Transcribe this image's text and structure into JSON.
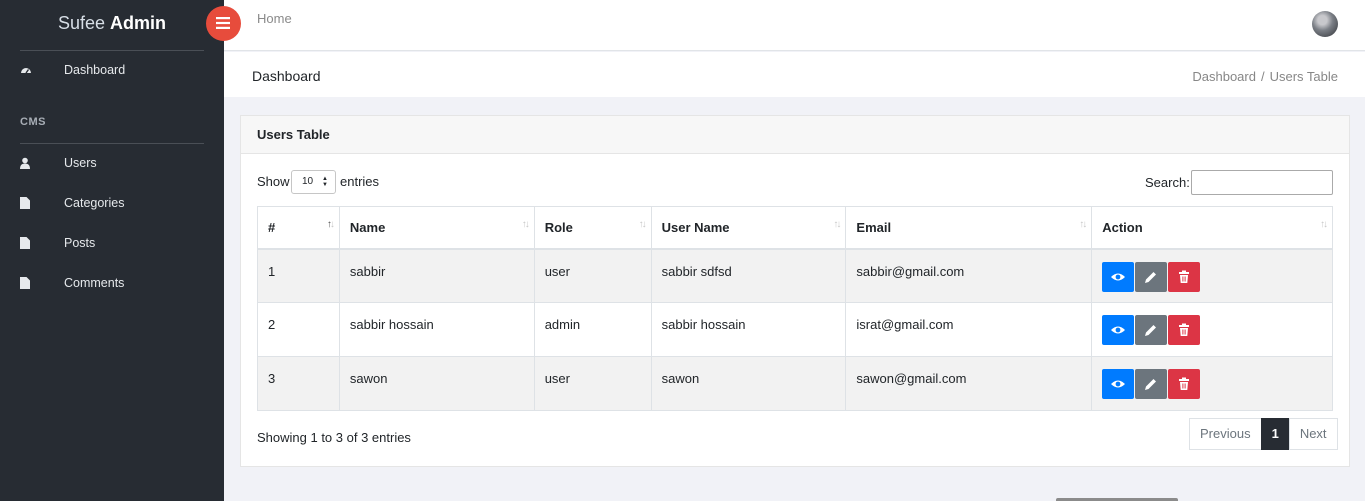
{
  "brand": {
    "part1": "Sufee",
    "part2": "Admin"
  },
  "sidebar": {
    "dashboard_label": "Dashboard",
    "section_title": "CMS",
    "items": [
      {
        "label": "Users",
        "icon": "user-icon"
      },
      {
        "label": "Categories",
        "icon": "file-icon"
      },
      {
        "label": "Posts",
        "icon": "file-icon"
      },
      {
        "label": "Comments",
        "icon": "file-icon"
      }
    ]
  },
  "header": {
    "home_label": "Home"
  },
  "page": {
    "title": "Dashboard",
    "breadcrumb": {
      "crumb1": "Dashboard",
      "sep": "/",
      "crumb2": "Users Table"
    }
  },
  "card": {
    "title": "Users Table"
  },
  "table_controls": {
    "show_label": "Show",
    "length_value": "10",
    "entries_label": "entries",
    "search_label": "Search:",
    "search_value": ""
  },
  "table": {
    "columns": [
      "#",
      "Name",
      "Role",
      "User Name",
      "Email",
      "Action"
    ],
    "rows": [
      {
        "id": "1",
        "name": "sabbir",
        "role": "user",
        "username": "sabbir sdfsd",
        "email": "sabbir@gmail.com"
      },
      {
        "id": "2",
        "name": "sabbir hossain",
        "role": "admin",
        "username": "sabbir hossain",
        "email": "israt@gmail.com"
      },
      {
        "id": "3",
        "name": "sawon",
        "role": "user",
        "username": "sawon",
        "email": "sawon@gmail.com"
      }
    ]
  },
  "footer": {
    "info": "Showing 1 to 3 of 3 entries",
    "prev": "Previous",
    "page": "1",
    "next": "Next"
  },
  "colors": {
    "sidebar_bg": "#272c33",
    "toggle_btn": "#e74c3c",
    "view_btn": "#007bff",
    "edit_btn": "#6c757d",
    "delete_btn": "#dc3545"
  }
}
